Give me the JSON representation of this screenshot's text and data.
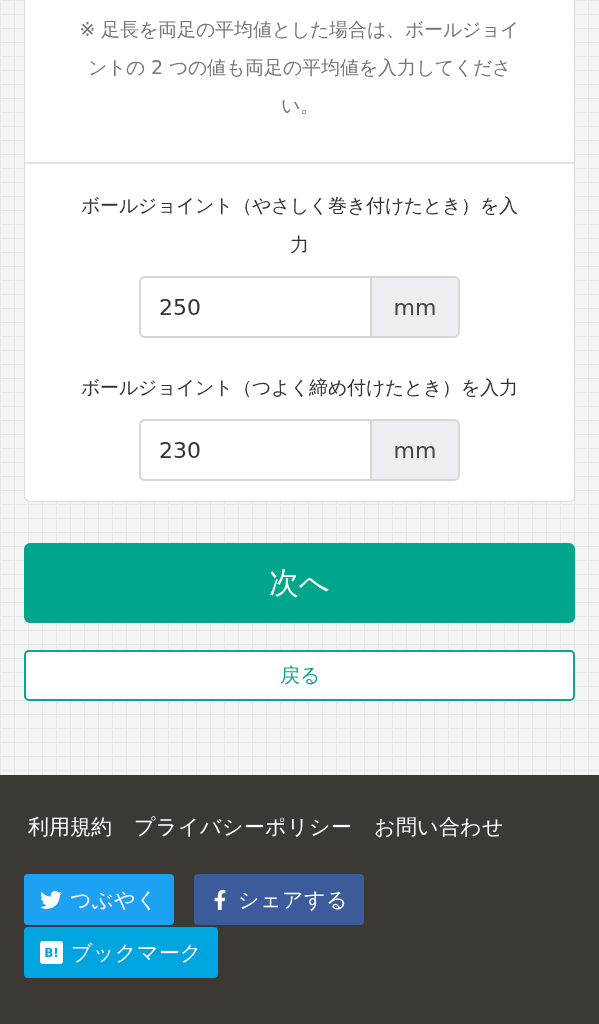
{
  "note": "※ 足長を両足の平均値とした場合は、ボールジョイントの 2 つの値も両足の平均値を入力してください。",
  "fields": [
    {
      "label": "ボールジョイント（やさしく巻き付けたとき）を入力",
      "value": "250",
      "unit": "mm"
    },
    {
      "label": "ボールジョイント（つよく締め付けたとき）を入力",
      "value": "230",
      "unit": "mm"
    }
  ],
  "next_button": "次へ",
  "back_button": "戻る",
  "footer": {
    "links": [
      "利用規約",
      "プライバシーポリシー",
      "お問い合わせ"
    ],
    "share_buttons": [
      {
        "kind": "twitter",
        "label": "つぶやく"
      },
      {
        "kind": "facebook",
        "label": "シェアする"
      },
      {
        "kind": "hatena",
        "label": "ブックマーク",
        "icon_text": "B!"
      }
    ]
  }
}
